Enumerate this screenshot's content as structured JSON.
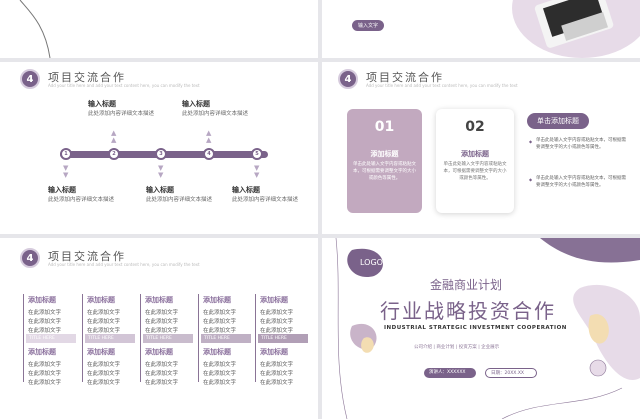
{
  "slide_tr": {
    "pill_text": "输入文字"
  },
  "slide_timeline": {
    "badge": "4",
    "title": "项目交流合作",
    "subtitle": "Add your title here and add your text content here, you can modify the text",
    "nodes": [
      "1",
      "2",
      "3",
      "4",
      "5"
    ],
    "items": [
      {
        "head": "输入标题",
        "desc": "此处添加内容详细文本描述"
      },
      {
        "head": "输入标题",
        "desc": "此处添加内容详细文本描述"
      },
      {
        "head": "输入标题",
        "desc": "此处添加内容详细文本描述"
      },
      {
        "head": "输入标题",
        "desc": "此处添加内容详细文本描述"
      },
      {
        "head": "输入标题",
        "desc": "此处添加内容详细文本描述"
      }
    ]
  },
  "slide_cards": {
    "badge": "4",
    "title": "项目交流合作",
    "subtitle": "Add your title here and add your text content here, you can modify the text",
    "card1": {
      "num": "01",
      "head": "添加标题",
      "desc": "单击此处输入文字内容或粘贴文本，可根据需要调整文字的大小或颜色等属性。"
    },
    "card2": {
      "num": "02",
      "head": "添加标题",
      "desc": "单击此处输入文字内容或粘贴文本，可根据需要调整文字的大小或颜色等属性。"
    },
    "side_pill": "单击添加标题",
    "side_points": [
      "单击此处输入文字内容或粘贴文本，可根据需要调整文字的大小或颜色等属性。",
      "单击此处输入文字内容或粘贴文本，可根据需要调整文字的大小或颜色等属性。"
    ]
  },
  "slide_columns": {
    "badge": "4",
    "title": "项目交流合作",
    "subtitle": "Add your title here and add your text content here, you can modify the text",
    "col_title": "添加标题",
    "item_text": "在此添加文字",
    "bar_text": "TITLE HERE"
  },
  "slide_cover": {
    "logo": "LOGO",
    "top": "金融商业计划",
    "main": "行业战略投资合作",
    "en": "INDUSTRIAL STRATEGIC INVESTMENT COOPERATION",
    "tags": [
      "公司介绍",
      "商业计划",
      "投资方案",
      "企业展示"
    ],
    "presenter_label": "演讲人：",
    "presenter": "XXXXXX",
    "date_label": "日期：",
    "date": "20XX.XX"
  },
  "colors": {
    "accent": "#7a628a",
    "light": "#c9b4c9",
    "pale": "#e9dfea",
    "peach": "#f3ddb2"
  }
}
